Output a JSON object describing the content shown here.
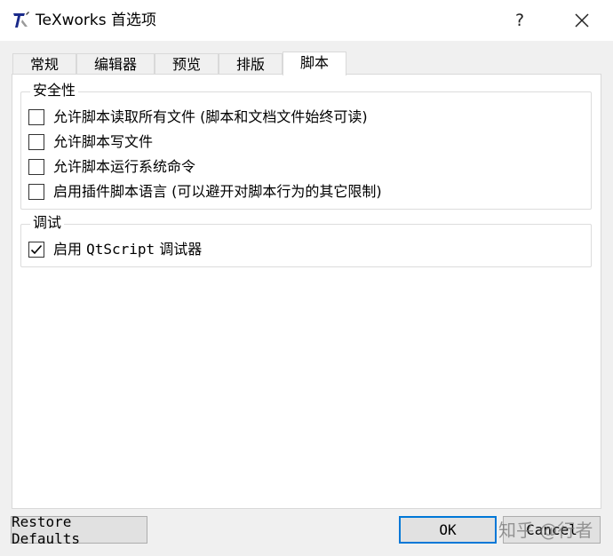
{
  "window": {
    "title": "TeXworks 首选项",
    "help_glyph": "?",
    "close_glyph": "✕"
  },
  "tabs": [
    {
      "label": "常规"
    },
    {
      "label": "编辑器"
    },
    {
      "label": "预览"
    },
    {
      "label": "排版"
    },
    {
      "label": "脚本",
      "active": true
    }
  ],
  "security": {
    "title": "安全性",
    "options": [
      {
        "label": "允许脚本读取所有文件 (脚本和文档文件始终可读)",
        "checked": false
      },
      {
        "label": "允许脚本写文件",
        "checked": false
      },
      {
        "label": "允许脚本运行系统命令",
        "checked": false
      },
      {
        "label": "启用插件脚本语言 (可以避开对脚本行为的其它限制)",
        "checked": false
      }
    ]
  },
  "debug": {
    "title": "调试",
    "options": [
      {
        "label_prefix": "启用 ",
        "label_mono": "QtScript",
        "label_suffix": " 调试器",
        "checked": true
      }
    ]
  },
  "buttons": {
    "restore": "Restore Defaults",
    "ok": "OK",
    "cancel": "Cancel"
  },
  "watermark": "知乎 @行者",
  "icons": {
    "app": "texworks-app-icon",
    "close": "close-icon",
    "help": "help-icon",
    "check": "checkmark-icon"
  }
}
